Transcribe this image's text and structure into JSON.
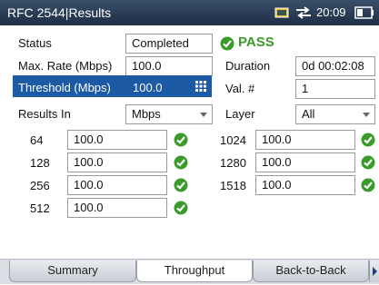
{
  "header": {
    "title": "RFC 2544|Results",
    "time": "20:09"
  },
  "status": {
    "label": "Status",
    "value": "Completed",
    "result": "PASS"
  },
  "max_rate": {
    "label": "Max. Rate (Mbps)",
    "value": "100.0"
  },
  "duration": {
    "label": "Duration",
    "value": "0d 00:02:08"
  },
  "threshold": {
    "label": "Threshold (Mbps)",
    "value": "100.0"
  },
  "val": {
    "label": "Val. #",
    "value": "1"
  },
  "results_in": {
    "label": "Results In",
    "value": "Mbps"
  },
  "layer": {
    "label": "Layer",
    "value": "All"
  },
  "frames_left": [
    {
      "size": "64",
      "value": "100.0"
    },
    {
      "size": "128",
      "value": "100.0"
    },
    {
      "size": "256",
      "value": "100.0"
    },
    {
      "size": "512",
      "value": "100.0"
    }
  ],
  "frames_right": [
    {
      "size": "1024",
      "value": "100.0"
    },
    {
      "size": "1280",
      "value": "100.0"
    },
    {
      "size": "1518",
      "value": "100.0"
    }
  ],
  "tabs": [
    {
      "label": "Summary"
    },
    {
      "label": "Throughput"
    },
    {
      "label": "Back-to-Back"
    }
  ],
  "colors": {
    "header": "#2a3d57",
    "highlight": "#1d5aa6",
    "pass": "#3a9a2a"
  }
}
